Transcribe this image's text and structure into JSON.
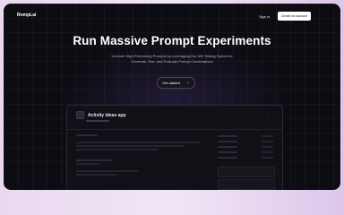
{
  "brand": {
    "logo_text": "RompLai"
  },
  "nav": {
    "signin_label": "Sign in",
    "create_account_label": "Create an account"
  },
  "hero": {
    "title": "Run Massive Prompt Experiments",
    "subtitle": "Uncover High-Performing Prompts by Leveraging Our A/B Testing System to Generate, Test, and Evaluate Prompt Combinations",
    "cta_label": "Get started",
    "cta_icon": "arrow-right-icon"
  },
  "app_preview": {
    "title": "Activity ideas app",
    "menu_icon": "more-dots-icon"
  }
}
